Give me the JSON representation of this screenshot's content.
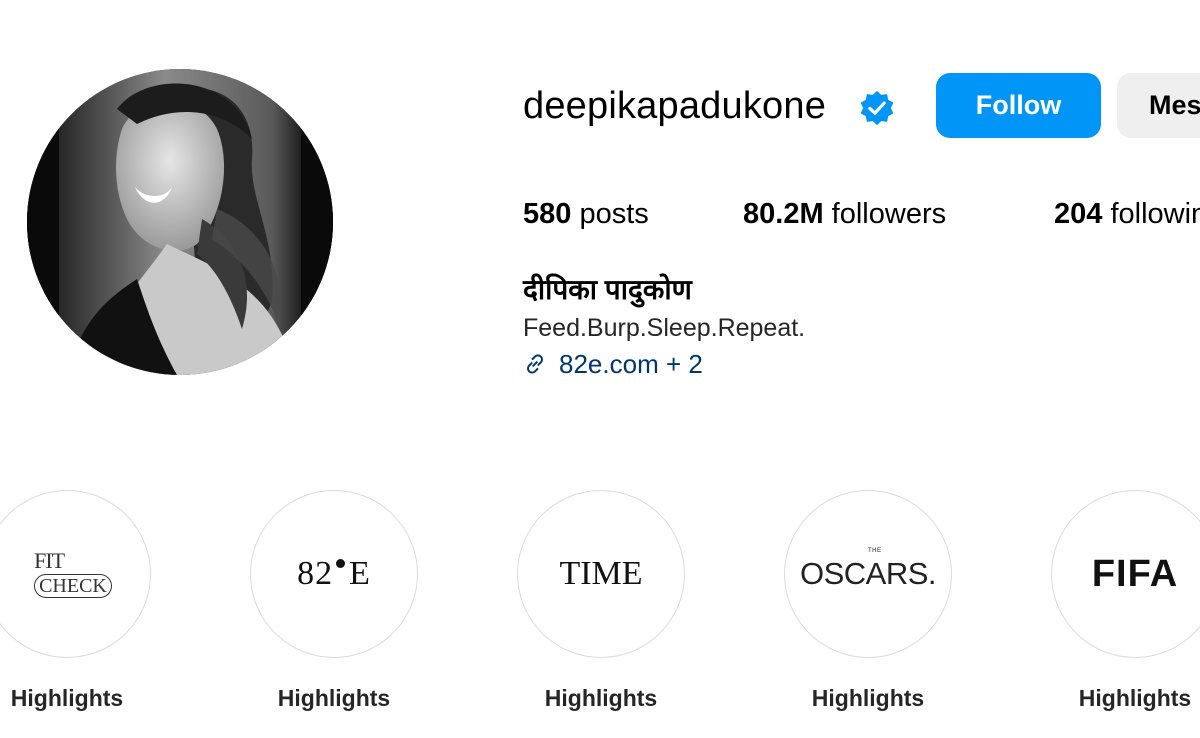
{
  "profile": {
    "username": "deepikapadukone",
    "verified": true,
    "follow_label": "Follow",
    "message_label": "Message",
    "stats": {
      "posts_count": "580",
      "posts_label": "posts",
      "followers_count": "80.2M",
      "followers_label": "followers",
      "following_count": "204",
      "following_label": "following"
    },
    "full_name": "दीपिका पादुकोण",
    "bio": "Feed.Burp.Sleep.Repeat.",
    "link_text": "82e.com + 2"
  },
  "highlights": [
    {
      "label": "Highlights",
      "logo": {
        "line1": "FIT",
        "line2": "CHECK"
      }
    },
    {
      "label": "Highlights",
      "logo": {
        "left": "82",
        "right": "E"
      }
    },
    {
      "label": "Highlights",
      "logo": {
        "text": "TIME"
      }
    },
    {
      "label": "Highlights",
      "logo": {
        "small": "THE",
        "text": "OSCARS."
      }
    },
    {
      "label": "Highlights",
      "logo": {
        "text": "FIFA"
      }
    }
  ],
  "colors": {
    "accent": "#0095f6",
    "link": "#00376b",
    "verified": "#0095f6",
    "secondary_button": "#efefef",
    "highlight_border": "#dbdbdb"
  },
  "icons": {
    "verified": "verified-badge-icon",
    "link": "link-chain-icon"
  }
}
